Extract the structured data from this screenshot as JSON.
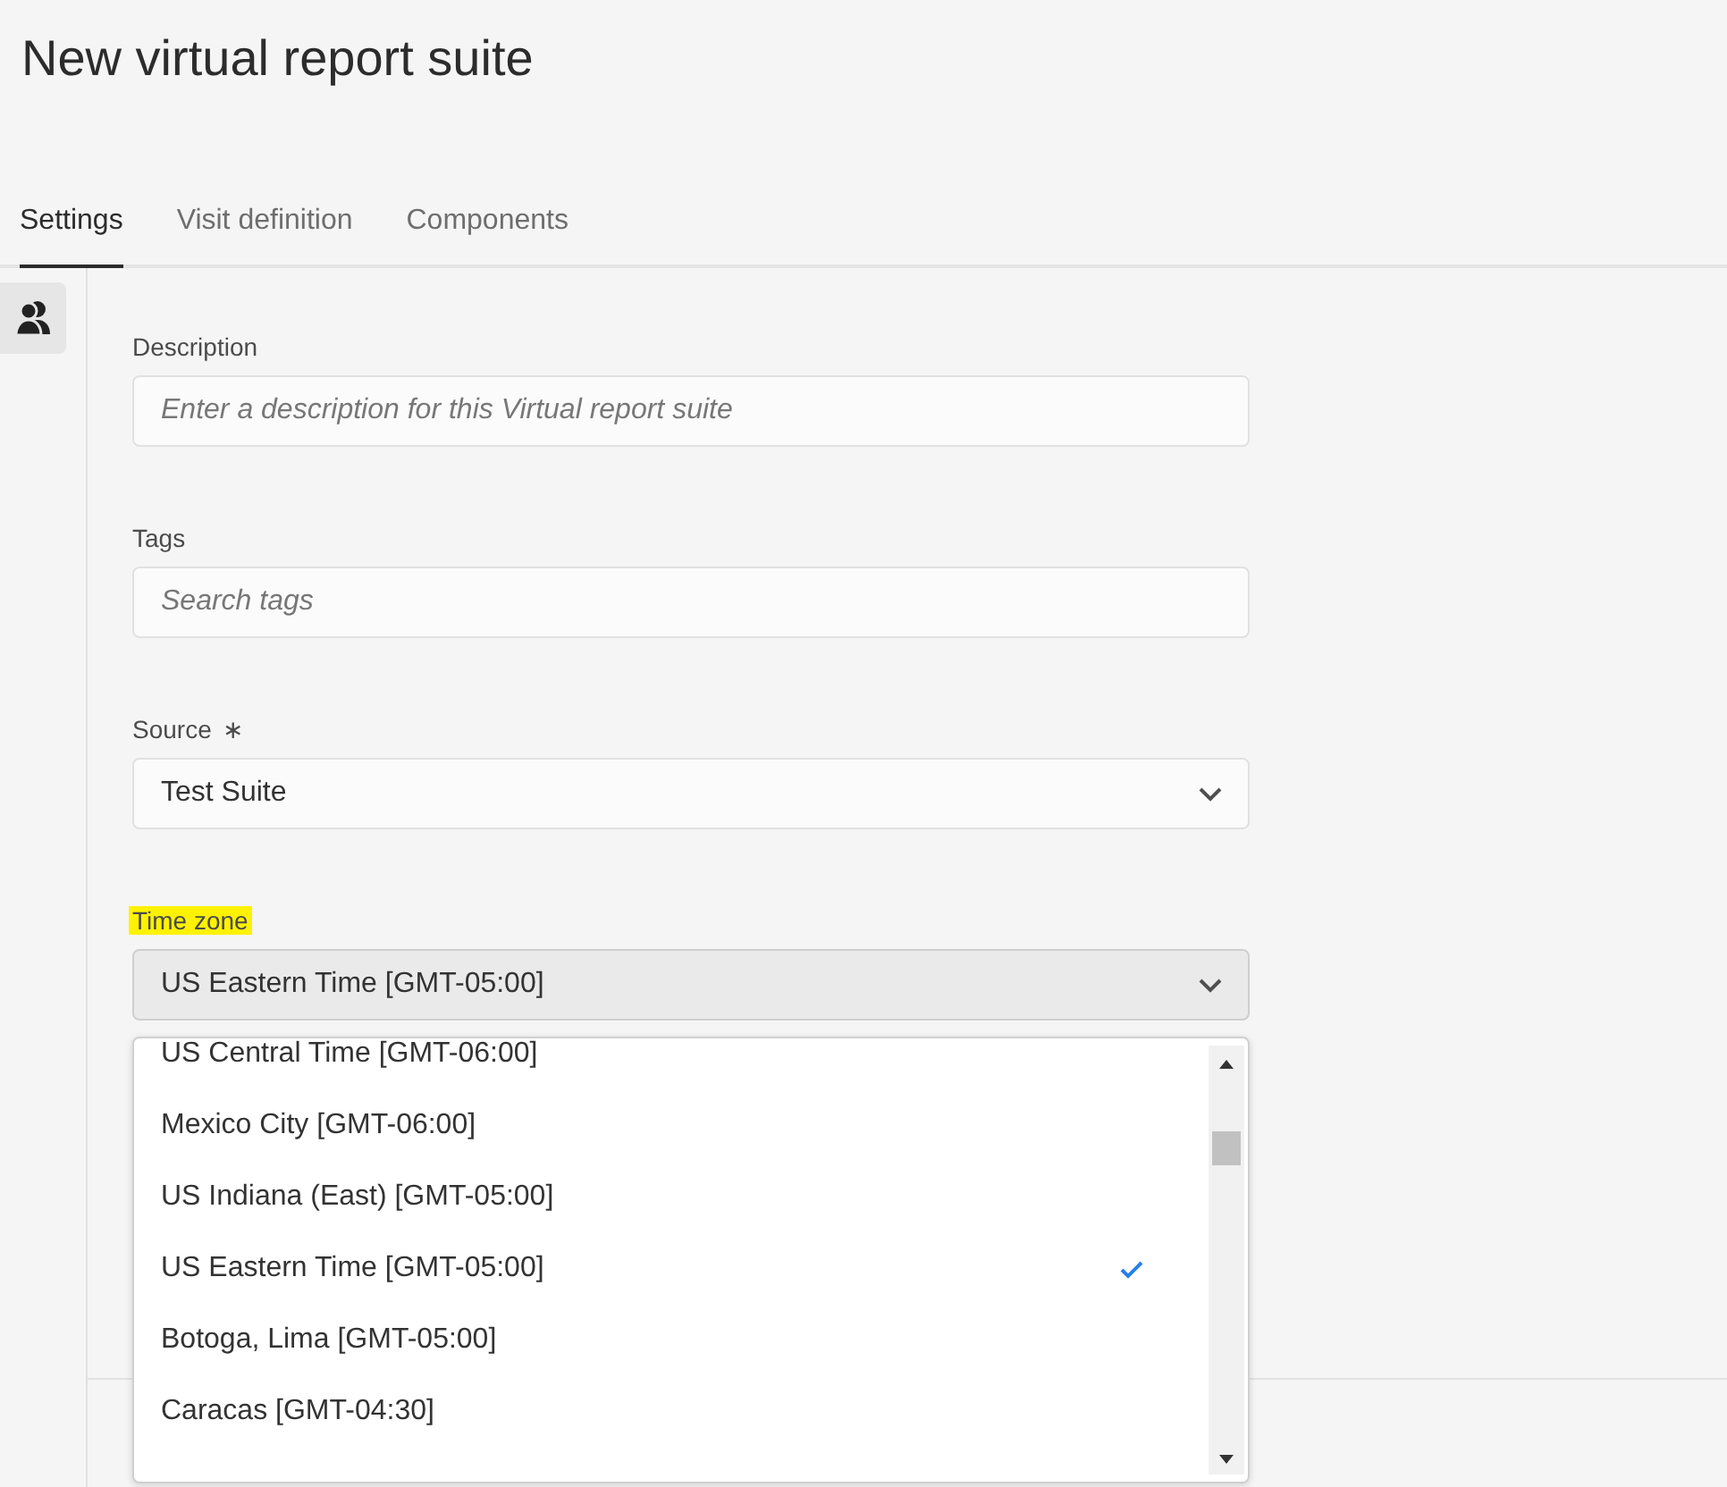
{
  "title": "New virtual report suite",
  "tabs": [
    {
      "label": "Settings",
      "selected": true
    },
    {
      "label": "Visit definition",
      "selected": false
    },
    {
      "label": "Components",
      "selected": false
    }
  ],
  "form": {
    "fields": [
      {
        "kind": "text",
        "label": "Description",
        "placeholder": "Enter a description for this Virtual report suite"
      },
      {
        "kind": "text",
        "label": "Tags",
        "placeholder": "Search tags"
      },
      {
        "kind": "select",
        "label": "Source",
        "required_mark": "∗",
        "value": "Test Suite"
      },
      {
        "kind": "select",
        "label": "Time zone",
        "highlighted": true,
        "open": true,
        "value": "US Eastern Time [GMT-05:00]"
      }
    ]
  },
  "time_zone_options": [
    {
      "label": "US Central Time [GMT-06:00]",
      "selected": false
    },
    {
      "label": "Mexico City [GMT-06:00]",
      "selected": false
    },
    {
      "label": "US Indiana (East) [GMT-05:00]",
      "selected": false
    },
    {
      "label": "US Eastern Time [GMT-05:00]",
      "selected": true
    },
    {
      "label": "Botoga, Lima [GMT-05:00]",
      "selected": false
    },
    {
      "label": "Caracas [GMT-04:30]",
      "selected": false
    }
  ]
}
